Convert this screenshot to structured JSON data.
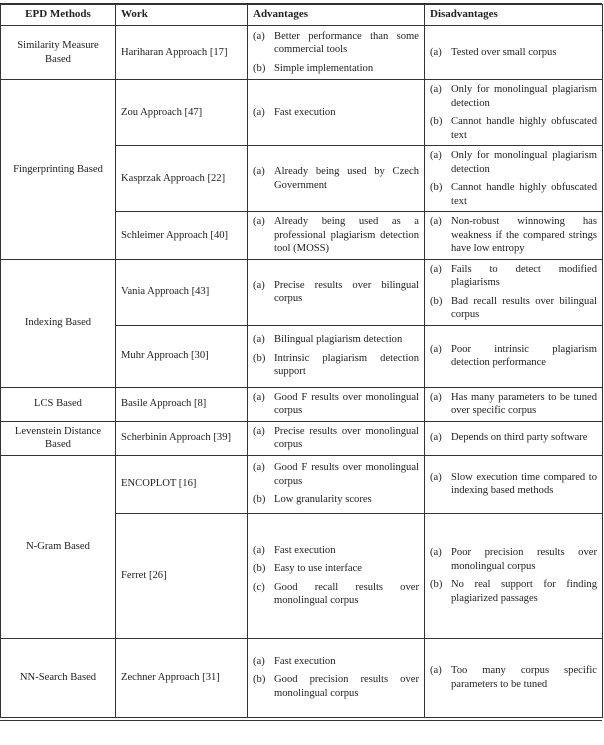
{
  "table": {
    "headers": [
      "EPD Methods",
      "Work",
      "Advantages",
      "Disadvantages"
    ],
    "groups": [
      {
        "method": "Similarity Measure Based",
        "rows": [
          {
            "work": "Hariharan Approach [17]",
            "advantages": [
              "Better performance than some commercial tools",
              "Simple implementation"
            ],
            "disadvantages": [
              "Tested over small corpus"
            ]
          }
        ]
      },
      {
        "method": "Fingerprinting Based",
        "rows": [
          {
            "work": "Zou Approach [47]",
            "advantages": [
              "Fast execution"
            ],
            "disadvantages": [
              "Only for monolingual plagiarism detection",
              "Cannot handle highly obfuscated text"
            ]
          },
          {
            "work": "Kasprzak Approach [22]",
            "advantages": [
              "Already being used by Czech Government"
            ],
            "disadvantages": [
              "Only for monolingual plagiarism detection",
              "Cannot handle highly obfuscated text"
            ]
          },
          {
            "work": "Schleimer Approach [40]",
            "advantages": [
              "Already being used as a professional plagiarism detection tool (MOSS)"
            ],
            "disadvantages": [
              "Non-robust winnowing has weakness if the compared strings have low entropy"
            ]
          }
        ]
      },
      {
        "method": "Indexing Based",
        "rows": [
          {
            "work": "Vania Approach [43]",
            "advantages": [
              "Precise results over bilingual corpus"
            ],
            "disadvantages": [
              "Fails to detect modified plagiarisms",
              "Bad recall results over bilingual corpus"
            ]
          },
          {
            "work": "Muhr Approach [30]",
            "advantages": [
              "Bilingual plagiarism detection",
              "Intrinsic plagiarism detection support"
            ],
            "disadvantages": [
              "Poor intrinsic plagiarism detection performance"
            ]
          }
        ]
      },
      {
        "method": "LCS Based",
        "rows": [
          {
            "work": "Basile Approach [8]",
            "advantages": [
              "Good F results over monolingual corpus"
            ],
            "disadvantages": [
              "Has many parameters to be tuned over specific corpus"
            ]
          }
        ]
      },
      {
        "method": "Levenstein Distance Based",
        "rows": [
          {
            "work": "Scherbinin Approach [39]",
            "advantages": [
              "Precise results over monolingual corpus"
            ],
            "disadvantages": [
              "Depends on third party software"
            ]
          }
        ]
      },
      {
        "method": "N-Gram Based",
        "rows": [
          {
            "work": "ENCOPLOT [16]",
            "advantages": [
              "Good F results over monolingual corpus",
              "Low granularity scores"
            ],
            "disadvantages": [
              "Slow execution time compared to indexing based methods"
            ]
          },
          {
            "work": "Ferret [26]",
            "advantages": [
              "Fast execution",
              "Easy to use interface",
              "Good recall results over monolingual corpus"
            ],
            "disadvantages": [
              "Poor precision results over monolingual corpus",
              "No real support for finding plagiarized passages"
            ]
          }
        ]
      },
      {
        "method": "NN-Search Based",
        "rows": [
          {
            "work": "Zechner Approach [31]",
            "advantages": [
              "Fast execution",
              "Good precision results over monolingual corpus"
            ],
            "disadvantages": [
              "Too many corpus specific parameters to be tuned"
            ]
          }
        ]
      }
    ],
    "markers": [
      "(a)",
      "(b)",
      "(c)"
    ]
  }
}
